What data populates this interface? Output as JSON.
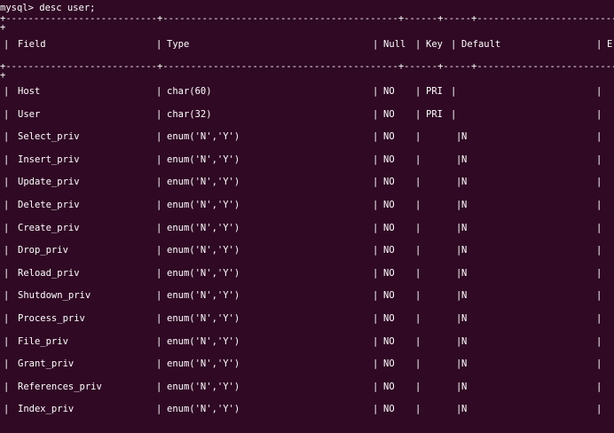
{
  "terminal": {
    "prompt_line": "mysql> desc user;",
    "sep_line": "+---------------------------+------------------------------------------+------+-----+-------------------------+--",
    "sep_cont": "+",
    "header": {
      "field": "Field",
      "type": "Type",
      "null": "Null",
      "key": "Key",
      "default": "Default",
      "extra": "E:"
    },
    "rows": [
      {
        "field": "Host",
        "type": "char(60)",
        "null": "NO",
        "key": "PRI",
        "default": ""
      },
      {
        "field": "User",
        "type": "char(32)",
        "null": "NO",
        "key": "PRI",
        "default": ""
      },
      {
        "field": "Select_priv",
        "type": "enum('N','Y')",
        "null": "NO",
        "key": "",
        "default": "N"
      },
      {
        "field": "Insert_priv",
        "type": "enum('N','Y')",
        "null": "NO",
        "key": "",
        "default": "N"
      },
      {
        "field": "Update_priv",
        "type": "enum('N','Y')",
        "null": "NO",
        "key": "",
        "default": "N"
      },
      {
        "field": "Delete_priv",
        "type": "enum('N','Y')",
        "null": "NO",
        "key": "",
        "default": "N"
      },
      {
        "field": "Create_priv",
        "type": "enum('N','Y')",
        "null": "NO",
        "key": "",
        "default": "N"
      },
      {
        "field": "Drop_priv",
        "type": "enum('N','Y')",
        "null": "NO",
        "key": "",
        "default": "N"
      },
      {
        "field": "Reload_priv",
        "type": "enum('N','Y')",
        "null": "NO",
        "key": "",
        "default": "N"
      },
      {
        "field": "Shutdown_priv",
        "type": "enum('N','Y')",
        "null": "NO",
        "key": "",
        "default": "N"
      },
      {
        "field": "Process_priv",
        "type": "enum('N','Y')",
        "null": "NO",
        "key": "",
        "default": "N"
      },
      {
        "field": "File_priv",
        "type": "enum('N','Y')",
        "null": "NO",
        "key": "",
        "default": "N"
      },
      {
        "field": "Grant_priv",
        "type": "enum('N','Y')",
        "null": "NO",
        "key": "",
        "default": "N"
      },
      {
        "field": "References_priv",
        "type": "enum('N','Y')",
        "null": "NO",
        "key": "",
        "default": "N"
      },
      {
        "field": "Index_priv",
        "type": "enum('N','Y')",
        "null": "NO",
        "key": "",
        "default": "N"
      }
    ]
  },
  "colors": {
    "background": "#300a24",
    "text": "#ffffff"
  }
}
